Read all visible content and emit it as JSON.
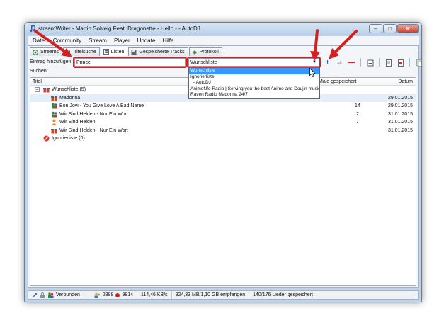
{
  "window": {
    "title": "streamWriter - Martin Solveig Feat. Dragonette - Hello - - AutoDJ"
  },
  "menu": [
    "Datei",
    "Community",
    "Stream",
    "Player",
    "Update",
    "Hilfe"
  ],
  "tabs": [
    {
      "label": "Streams"
    },
    {
      "label": "Titelsuche"
    },
    {
      "label": "Listen",
      "active": true
    },
    {
      "label": "Gespeicherte Tracks"
    },
    {
      "label": "Protokoll"
    }
  ],
  "toolbar": {
    "add_label": "Eintrag hinzufügen:",
    "add_value": "Prince",
    "search_label": "Suchen:",
    "list_value": "Wunschliste"
  },
  "dropdown": {
    "options": [
      "Wunschliste",
      "Ignorierliste",
      "- AutoDJ",
      "AnimeNfo Radio | Serving you the best Anime and Doujin music",
      "Raven Radio Madonna 24/7"
    ],
    "selected_index": 0
  },
  "list": {
    "columns": {
      "title": "Titel",
      "saved": "Male gespeichert",
      "date": "Datum"
    },
    "rows": [
      {
        "name": "Wunschliste (5)",
        "saved": "",
        "date": "",
        "level": 0,
        "icon": "gift-icon",
        "expandable": true
      },
      {
        "name": "Madonna",
        "saved": "",
        "date": "29.01.2015",
        "level": 1,
        "icon": "gift-icon",
        "selected": true
      },
      {
        "name": "Bon Jovi - You Give Love A Bad Name",
        "saved": "14",
        "date": "29.01.2015",
        "level": 1,
        "icon": "people-icon"
      },
      {
        "name": "Wir Sind Helden - Nur Ein Wort",
        "saved": "2",
        "date": "31.01.2015",
        "level": 1,
        "icon": "people-icon"
      },
      {
        "name": "Wir Sind Helden",
        "saved": "7",
        "date": "31.01.2015",
        "level": 1,
        "icon": "person-icon"
      },
      {
        "name": "Wir Sind Helden - Nur Ein Wort",
        "saved": "",
        "date": "31.01.2015",
        "level": 1,
        "icon": "gift-icon"
      },
      {
        "name": "Ignorierliste (0)",
        "saved": "",
        "date": "",
        "level": 0,
        "icon": "block-icon"
      }
    ]
  },
  "status": {
    "connection": "Verbunden",
    "users": "2388",
    "listeners": "9814",
    "speed": "114,46 KB/s",
    "received": "924,33 MB/1,10 GB empfangen",
    "songs": "140/176 Lieder gespeichert"
  },
  "colors": {
    "highlight": "#d42020",
    "selection": "#3399ff"
  }
}
